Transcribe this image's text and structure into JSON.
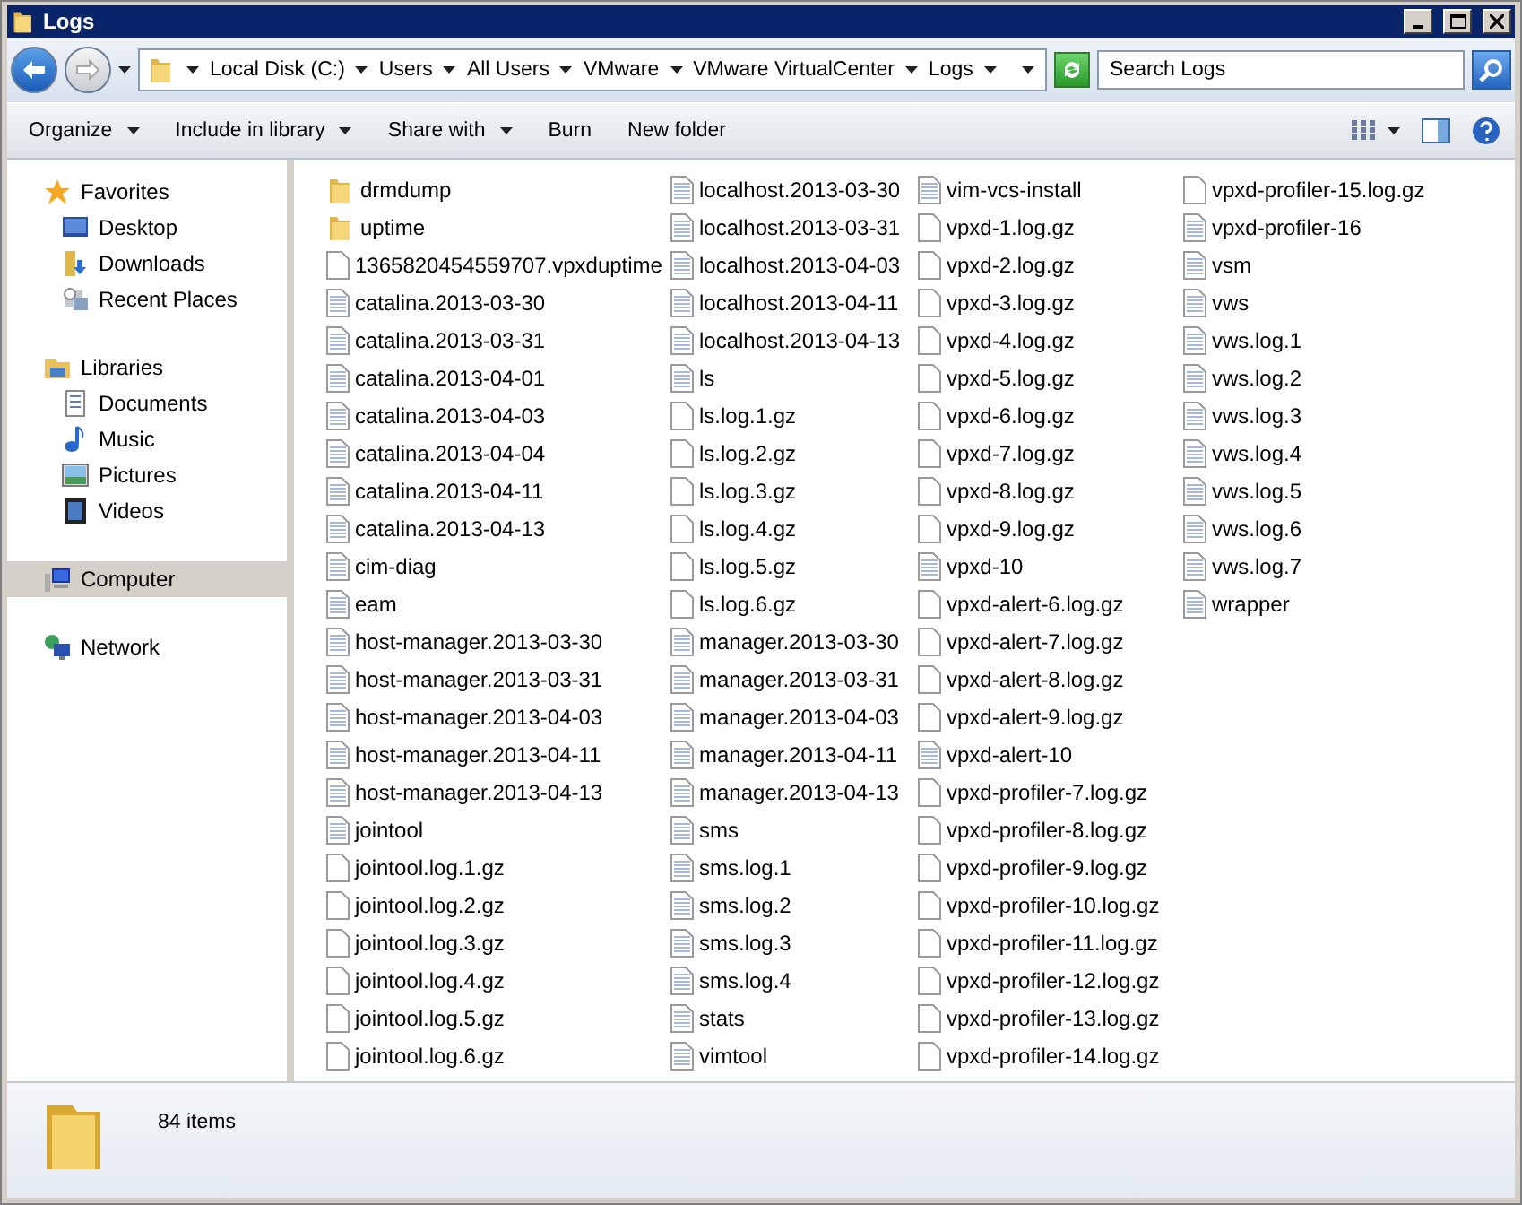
{
  "window": {
    "title": "Logs"
  },
  "address": {
    "crumbs": [
      "Local Disk (C:)",
      "Users",
      "All Users",
      "VMware",
      "VMware VirtualCenter",
      "Logs"
    ]
  },
  "search": {
    "placeholder": "Search Logs"
  },
  "toolbar": [
    {
      "label": "Organize",
      "menu": true
    },
    {
      "label": "Include in library",
      "menu": true
    },
    {
      "label": "Share with",
      "menu": true
    },
    {
      "label": "Burn",
      "menu": false
    },
    {
      "label": "New folder",
      "menu": false
    }
  ],
  "sidebar": {
    "groups": [
      {
        "label": "Favorites",
        "kind": "star",
        "selected": false,
        "items": [
          {
            "label": "Desktop",
            "kind": "desktop"
          },
          {
            "label": "Downloads",
            "kind": "downloads"
          },
          {
            "label": "Recent Places",
            "kind": "recent"
          }
        ]
      },
      {
        "label": "Libraries",
        "kind": "library",
        "selected": false,
        "items": [
          {
            "label": "Documents",
            "kind": "documents"
          },
          {
            "label": "Music",
            "kind": "music"
          },
          {
            "label": "Pictures",
            "kind": "pictures"
          },
          {
            "label": "Videos",
            "kind": "videos"
          }
        ]
      },
      {
        "label": "Computer",
        "kind": "computer",
        "selected": true
      },
      {
        "label": "Network",
        "kind": "network",
        "selected": false
      }
    ]
  },
  "files": [
    {
      "name": "drmdump",
      "kind": "folder"
    },
    {
      "name": "uptime",
      "kind": "folder"
    },
    {
      "name": "1365820454559707.vpxduptime",
      "kind": "file"
    },
    {
      "name": "catalina.2013-03-30",
      "kind": "text"
    },
    {
      "name": "catalina.2013-03-31",
      "kind": "text"
    },
    {
      "name": "catalina.2013-04-01",
      "kind": "text"
    },
    {
      "name": "catalina.2013-04-03",
      "kind": "text"
    },
    {
      "name": "catalina.2013-04-04",
      "kind": "text"
    },
    {
      "name": "catalina.2013-04-11",
      "kind": "text"
    },
    {
      "name": "catalina.2013-04-13",
      "kind": "text"
    },
    {
      "name": "cim-diag",
      "kind": "text"
    },
    {
      "name": "eam",
      "kind": "text"
    },
    {
      "name": "host-manager.2013-03-30",
      "kind": "text"
    },
    {
      "name": "host-manager.2013-03-31",
      "kind": "text"
    },
    {
      "name": "host-manager.2013-04-03",
      "kind": "text"
    },
    {
      "name": "host-manager.2013-04-11",
      "kind": "text"
    },
    {
      "name": "host-manager.2013-04-13",
      "kind": "text"
    },
    {
      "name": "jointool",
      "kind": "text"
    },
    {
      "name": "jointool.log.1.gz",
      "kind": "file"
    },
    {
      "name": "jointool.log.2.gz",
      "kind": "file"
    },
    {
      "name": "jointool.log.3.gz",
      "kind": "file"
    },
    {
      "name": "jointool.log.4.gz",
      "kind": "file"
    },
    {
      "name": "jointool.log.5.gz",
      "kind": "file"
    },
    {
      "name": "jointool.log.6.gz",
      "kind": "file"
    },
    {
      "name": "localhost.2013-03-30",
      "kind": "text"
    },
    {
      "name": "localhost.2013-03-31",
      "kind": "text"
    },
    {
      "name": "localhost.2013-04-03",
      "kind": "text"
    },
    {
      "name": "localhost.2013-04-11",
      "kind": "text"
    },
    {
      "name": "localhost.2013-04-13",
      "kind": "text"
    },
    {
      "name": "ls",
      "kind": "text"
    },
    {
      "name": "ls.log.1.gz",
      "kind": "file"
    },
    {
      "name": "ls.log.2.gz",
      "kind": "file"
    },
    {
      "name": "ls.log.3.gz",
      "kind": "file"
    },
    {
      "name": "ls.log.4.gz",
      "kind": "file"
    },
    {
      "name": "ls.log.5.gz",
      "kind": "file"
    },
    {
      "name": "ls.log.6.gz",
      "kind": "file"
    },
    {
      "name": "manager.2013-03-30",
      "kind": "text"
    },
    {
      "name": "manager.2013-03-31",
      "kind": "text"
    },
    {
      "name": "manager.2013-04-03",
      "kind": "text"
    },
    {
      "name": "manager.2013-04-11",
      "kind": "text"
    },
    {
      "name": "manager.2013-04-13",
      "kind": "text"
    },
    {
      "name": "sms",
      "kind": "text"
    },
    {
      "name": "sms.log.1",
      "kind": "text"
    },
    {
      "name": "sms.log.2",
      "kind": "text"
    },
    {
      "name": "sms.log.3",
      "kind": "text"
    },
    {
      "name": "sms.log.4",
      "kind": "text"
    },
    {
      "name": "stats",
      "kind": "text"
    },
    {
      "name": "vimtool",
      "kind": "text"
    },
    {
      "name": "vim-vcs-install",
      "kind": "text"
    },
    {
      "name": "vpxd-1.log.gz",
      "kind": "file"
    },
    {
      "name": "vpxd-2.log.gz",
      "kind": "file"
    },
    {
      "name": "vpxd-3.log.gz",
      "kind": "file"
    },
    {
      "name": "vpxd-4.log.gz",
      "kind": "file"
    },
    {
      "name": "vpxd-5.log.gz",
      "kind": "file"
    },
    {
      "name": "vpxd-6.log.gz",
      "kind": "file"
    },
    {
      "name": "vpxd-7.log.gz",
      "kind": "file"
    },
    {
      "name": "vpxd-8.log.gz",
      "kind": "file"
    },
    {
      "name": "vpxd-9.log.gz",
      "kind": "file"
    },
    {
      "name": "vpxd-10",
      "kind": "text"
    },
    {
      "name": "vpxd-alert-6.log.gz",
      "kind": "file"
    },
    {
      "name": "vpxd-alert-7.log.gz",
      "kind": "file"
    },
    {
      "name": "vpxd-alert-8.log.gz",
      "kind": "file"
    },
    {
      "name": "vpxd-alert-9.log.gz",
      "kind": "file"
    },
    {
      "name": "vpxd-alert-10",
      "kind": "text"
    },
    {
      "name": "vpxd-profiler-7.log.gz",
      "kind": "file"
    },
    {
      "name": "vpxd-profiler-8.log.gz",
      "kind": "file"
    },
    {
      "name": "vpxd-profiler-9.log.gz",
      "kind": "file"
    },
    {
      "name": "vpxd-profiler-10.log.gz",
      "kind": "file"
    },
    {
      "name": "vpxd-profiler-11.log.gz",
      "kind": "file"
    },
    {
      "name": "vpxd-profiler-12.log.gz",
      "kind": "file"
    },
    {
      "name": "vpxd-profiler-13.log.gz",
      "kind": "file"
    },
    {
      "name": "vpxd-profiler-14.log.gz",
      "kind": "file"
    },
    {
      "name": "vpxd-profiler-15.log.gz",
      "kind": "file"
    },
    {
      "name": "vpxd-profiler-16",
      "kind": "text"
    },
    {
      "name": "vsm",
      "kind": "text"
    },
    {
      "name": "vws",
      "kind": "text"
    },
    {
      "name": "vws.log.1",
      "kind": "text"
    },
    {
      "name": "vws.log.2",
      "kind": "text"
    },
    {
      "name": "vws.log.3",
      "kind": "text"
    },
    {
      "name": "vws.log.4",
      "kind": "text"
    },
    {
      "name": "vws.log.5",
      "kind": "text"
    },
    {
      "name": "vws.log.6",
      "kind": "text"
    },
    {
      "name": "vws.log.7",
      "kind": "text"
    },
    {
      "name": "wrapper",
      "kind": "text"
    }
  ],
  "status_bar": {
    "count": "84 items"
  }
}
